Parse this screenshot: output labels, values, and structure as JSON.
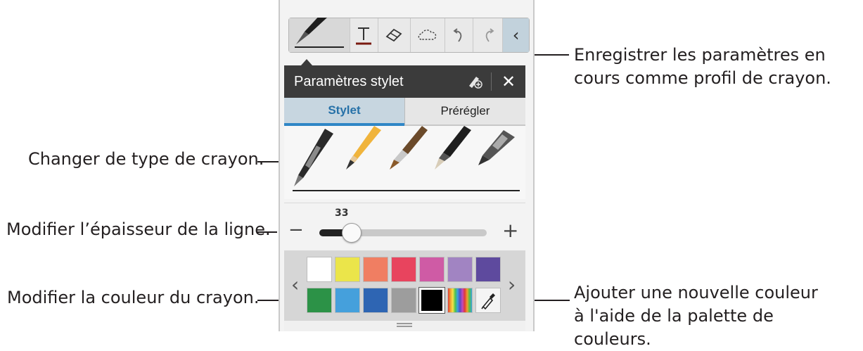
{
  "callouts": {
    "save_profile": "Enregistrer les paramètres en cours comme profil de crayon.",
    "change_pen_type": "Changer de type de crayon.",
    "modify_thickness": "Modifier l’épaisseur de la ligne.",
    "modify_color": "Modifier la couleur du crayon.",
    "add_color": "Ajouter une nouvelle couleur à l'aide de la palette de couleurs."
  },
  "toolbar": {
    "items": [
      "pen-icon",
      "text-icon",
      "eraser-icon",
      "lasso-icon",
      "undo-icon",
      "redo-icon",
      "collapse-icon"
    ],
    "collapse_glyph": "‹"
  },
  "settings": {
    "title": "Paramètres stylet",
    "close_glyph": "✕"
  },
  "tabs": {
    "stylet": "Stylet",
    "preset": "Prérégler"
  },
  "pen_types": [
    "ballpoint-pen",
    "pencil",
    "brush",
    "calligraphy-pen",
    "marker"
  ],
  "thickness": {
    "value": "33",
    "level_fraction": 0.15,
    "minus": "−",
    "plus": "+"
  },
  "palette": {
    "colors": [
      "#ffffff",
      "#ebe54a",
      "#f07e62",
      "#e8445e",
      "#cf5ba5",
      "#a184c2",
      "#5e4a9e",
      "#2c9247",
      "#45a0dc",
      "#2e65b3",
      "#9d9d9d",
      "#000000",
      "rainbow",
      "eyedropper"
    ],
    "selected": "#000000",
    "prev_glyph": "‹",
    "next_glyph": "›"
  }
}
